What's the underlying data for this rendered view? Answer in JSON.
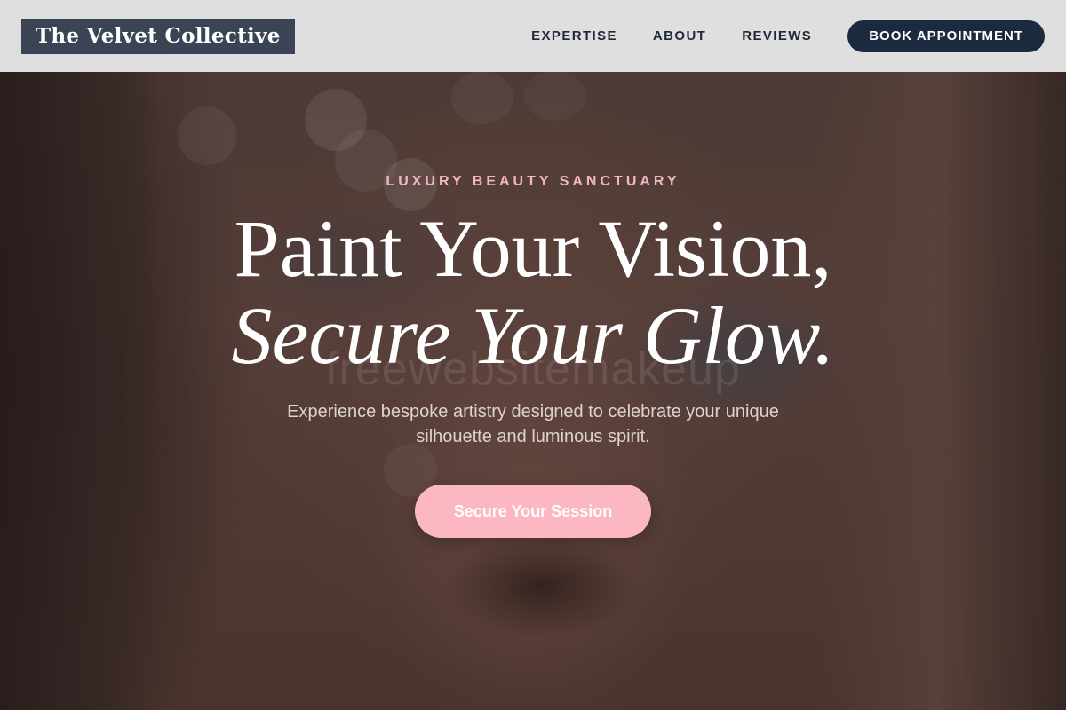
{
  "header": {
    "logo": "The Velvet Collective",
    "nav": [
      "EXPERTISE",
      "ABOUT",
      "REVIEWS"
    ],
    "cta_label": "BOOK APPOINTMENT"
  },
  "hero": {
    "eyebrow": "LUXURY BEAUTY SANCTUARY",
    "headline_line1": "Paint Your Vision,",
    "headline_line2": "Secure Your Glow.",
    "watermark": "freewebsitemakeup",
    "subtext": "Experience bespoke artistry designed to celebrate your unique silhouette and luminous spirit.",
    "cta_label": "Secure Your Session"
  },
  "colors": {
    "header_bg": "#e8e8e9",
    "logo_bg": "#3b4454",
    "nav_text": "#1f2937",
    "book_button_bg": "#1c2a3f",
    "accent_pink": "#fbb7c2",
    "eyebrow_pink": "#f5b6c1"
  }
}
